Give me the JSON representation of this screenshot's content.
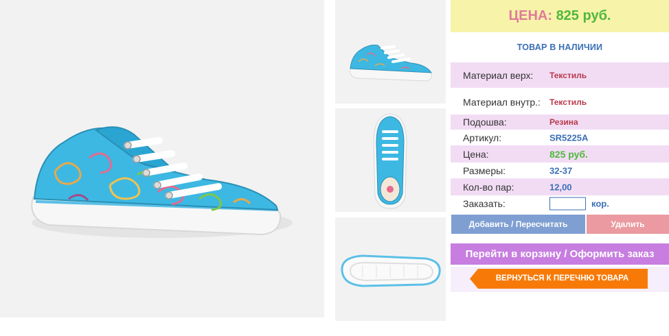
{
  "product": {
    "price_label": "ЦЕНА:",
    "price_value": "825 руб.",
    "stock_status": "ТОВАР В НАЛИЧИИ"
  },
  "specs": [
    {
      "label": "Материал верх:",
      "value": "Текстиль"
    },
    {
      "label": "Материал внутр.:",
      "value": "Текстиль"
    },
    {
      "label": "Подошва:",
      "value": "Резина"
    },
    {
      "label": "Артикул:",
      "value": "SR5225A"
    },
    {
      "label": "Цена:",
      "value": "825 руб."
    },
    {
      "label": "Размеры:",
      "value": "32-37"
    },
    {
      "label": "Кол-во пар:",
      "value": "12,00"
    }
  ],
  "order": {
    "label": "Заказать:",
    "quantity_value": "",
    "unit": "кор."
  },
  "buttons": {
    "add": "Добавить / Пересчитать",
    "delete": "Удалить",
    "cart": "Перейти в корзину / Оформить заказ",
    "back": "ВЕРНУТЬСЯ К ПЕРЕЧНЮ ТОВАРА"
  },
  "colors": {
    "price_banner_bg": "#f7f3a9",
    "price_label": "#e07a9a",
    "price_value": "#4fb83c",
    "row_highlight": "#f2dcf4",
    "add_button": "#7f9fd2",
    "delete_button": "#ea9aa0",
    "cart_button": "#c77ee0",
    "back_button": "#f77a08"
  },
  "images": {
    "main": "sneaker-side-view",
    "thumbs": [
      "sneaker-side-view",
      "sneaker-top-view",
      "sneaker-sole-view"
    ]
  }
}
